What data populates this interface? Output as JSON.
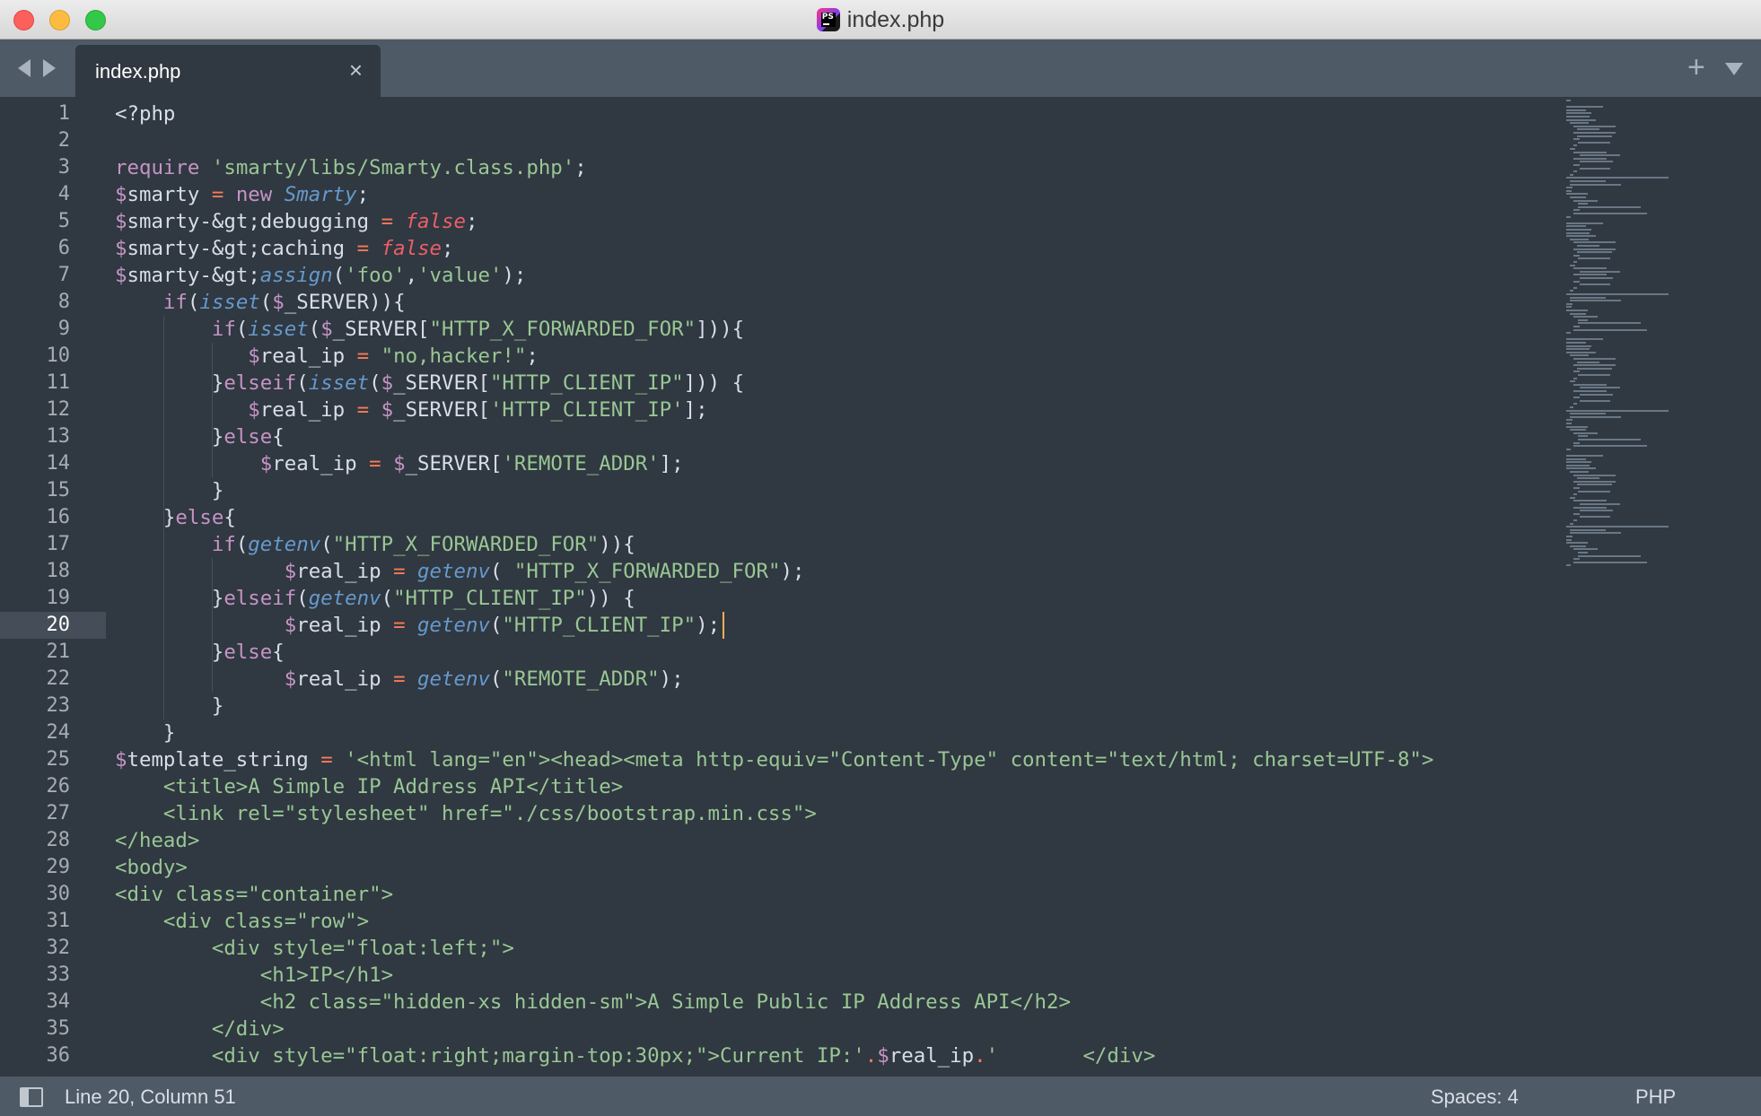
{
  "window": {
    "title": "index.php",
    "icon": "phpstorm-icon"
  },
  "tabs": [
    {
      "label": "index.php",
      "close_glyph": "×",
      "active": true
    }
  ],
  "tabbar": {
    "add_glyph": "+"
  },
  "editor": {
    "current_line": 20,
    "line_numbers": [
      "1",
      "2",
      "3",
      "4",
      "5",
      "6",
      "7",
      "8",
      "9",
      "10",
      "11",
      "12",
      "13",
      "14",
      "15",
      "16",
      "17",
      "18",
      "19",
      "20",
      "21",
      "22",
      "23",
      "24",
      "25",
      "26",
      "27",
      "28",
      "29",
      "30",
      "31",
      "32",
      "33",
      "34",
      "35",
      "36"
    ],
    "lines": [
      "<?php",
      "",
      "require 'smarty/libs/Smarty.class.php';",
      "$smarty = new Smarty;",
      "$smarty->debugging = false;",
      "$smarty->caching = false;",
      "$smarty->assign('foo','value');",
      "    if(isset($_SERVER)){",
      "        if(isset($_SERVER[\"HTTP_X_FORWARDED_FOR\"])){",
      "           $real_ip = \"no,hacker!\";",
      "        }elseif(isset($_SERVER[\"HTTP_CLIENT_IP\"])) {",
      "           $real_ip = $_SERVER['HTTP_CLIENT_IP'];",
      "        }else{",
      "            $real_ip = $_SERVER['REMOTE_ADDR'];",
      "        }",
      "    }else{",
      "        if(getenv(\"HTTP_X_FORWARDED_FOR\")){",
      "              $real_ip = getenv( \"HTTP_X_FORWARDED_FOR\");",
      "        }elseif(getenv(\"HTTP_CLIENT_IP\")) {",
      "              $real_ip = getenv(\"HTTP_CLIENT_IP\");",
      "        }else{",
      "              $real_ip = getenv(\"REMOTE_ADDR\");",
      "        }",
      "    }",
      "$template_string = '<html lang=\"en\"><head><meta http-equiv=\"Content-Type\" content=\"text/html; charset=UTF-8\">",
      "    <title>A Simple IP Address API</title>",
      "    <link rel=\"stylesheet\" href=\"./css/bootstrap.min.css\">",
      "</head>",
      "<body>",
      "<div class=\"container\">",
      "    <div class=\"row\">",
      "        <div style=\"float:left;\">",
      "            <h1>IP</h1>",
      "            <h2 class=\"hidden-xs hidden-sm\">A Simple Public IP Address API</h2>",
      "        </div>",
      "        <div style=\"float:right;margin-top:30px;\">Current IP:'.$real_ip.'       </div>"
    ]
  },
  "status": {
    "position": "Line 20, Column 51",
    "indentation": "Spaces: 4",
    "syntax": "PHP"
  }
}
